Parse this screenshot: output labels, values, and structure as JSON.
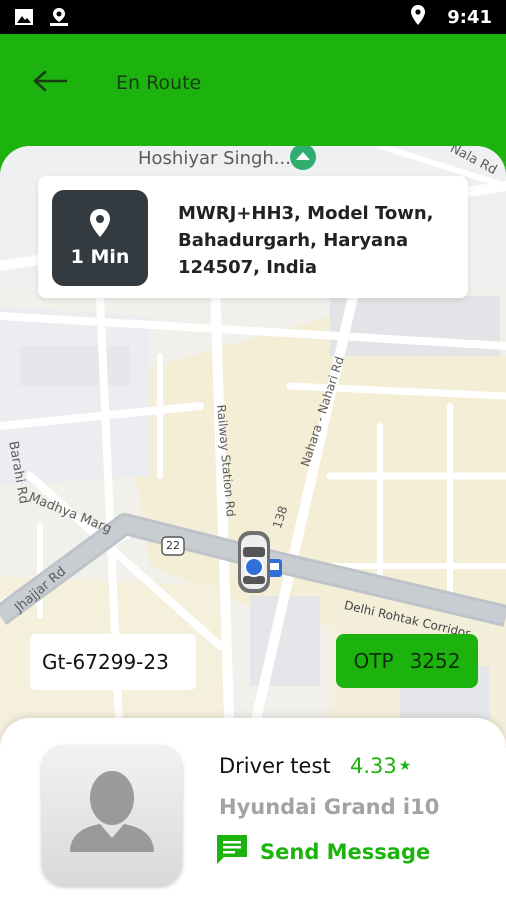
{
  "status_bar": {
    "time": "9:41",
    "icons": [
      "image-icon",
      "app-notification-icon",
      "location-icon"
    ]
  },
  "app_bar": {
    "title": "En Route",
    "back_icon": "arrow-left-icon"
  },
  "trip": {
    "eta": "1 Min",
    "address_lines": [
      "MWRJ+HH3, Model Town,",
      "Bahadurgarh, Haryana",
      "124507, India"
    ]
  },
  "map": {
    "labels": {
      "place": "Hoshiyar Singh...",
      "nala": "Nala Rd",
      "barahi": "Barahi Rd",
      "madhya": "Madhya Marg",
      "jhajjar": "Jhajjar Rd",
      "railway": "Railway Station Rd",
      "nahara": "Nahara - Nahari Rd",
      "route138": "138",
      "route22": "22",
      "corridor": "Delhi Rohtak Corridor"
    }
  },
  "vehicle_number": "Gt-67299-23",
  "otp": {
    "label": "OTP",
    "value": "3252"
  },
  "driver": {
    "name": "Driver test",
    "rating": "4.33",
    "car": "Hyundai Grand i10",
    "send_message_label": "Send Message"
  },
  "colors": {
    "primary": "#1db30f",
    "dark_box": "#333a40",
    "map_bg": "#f2f0ea"
  }
}
